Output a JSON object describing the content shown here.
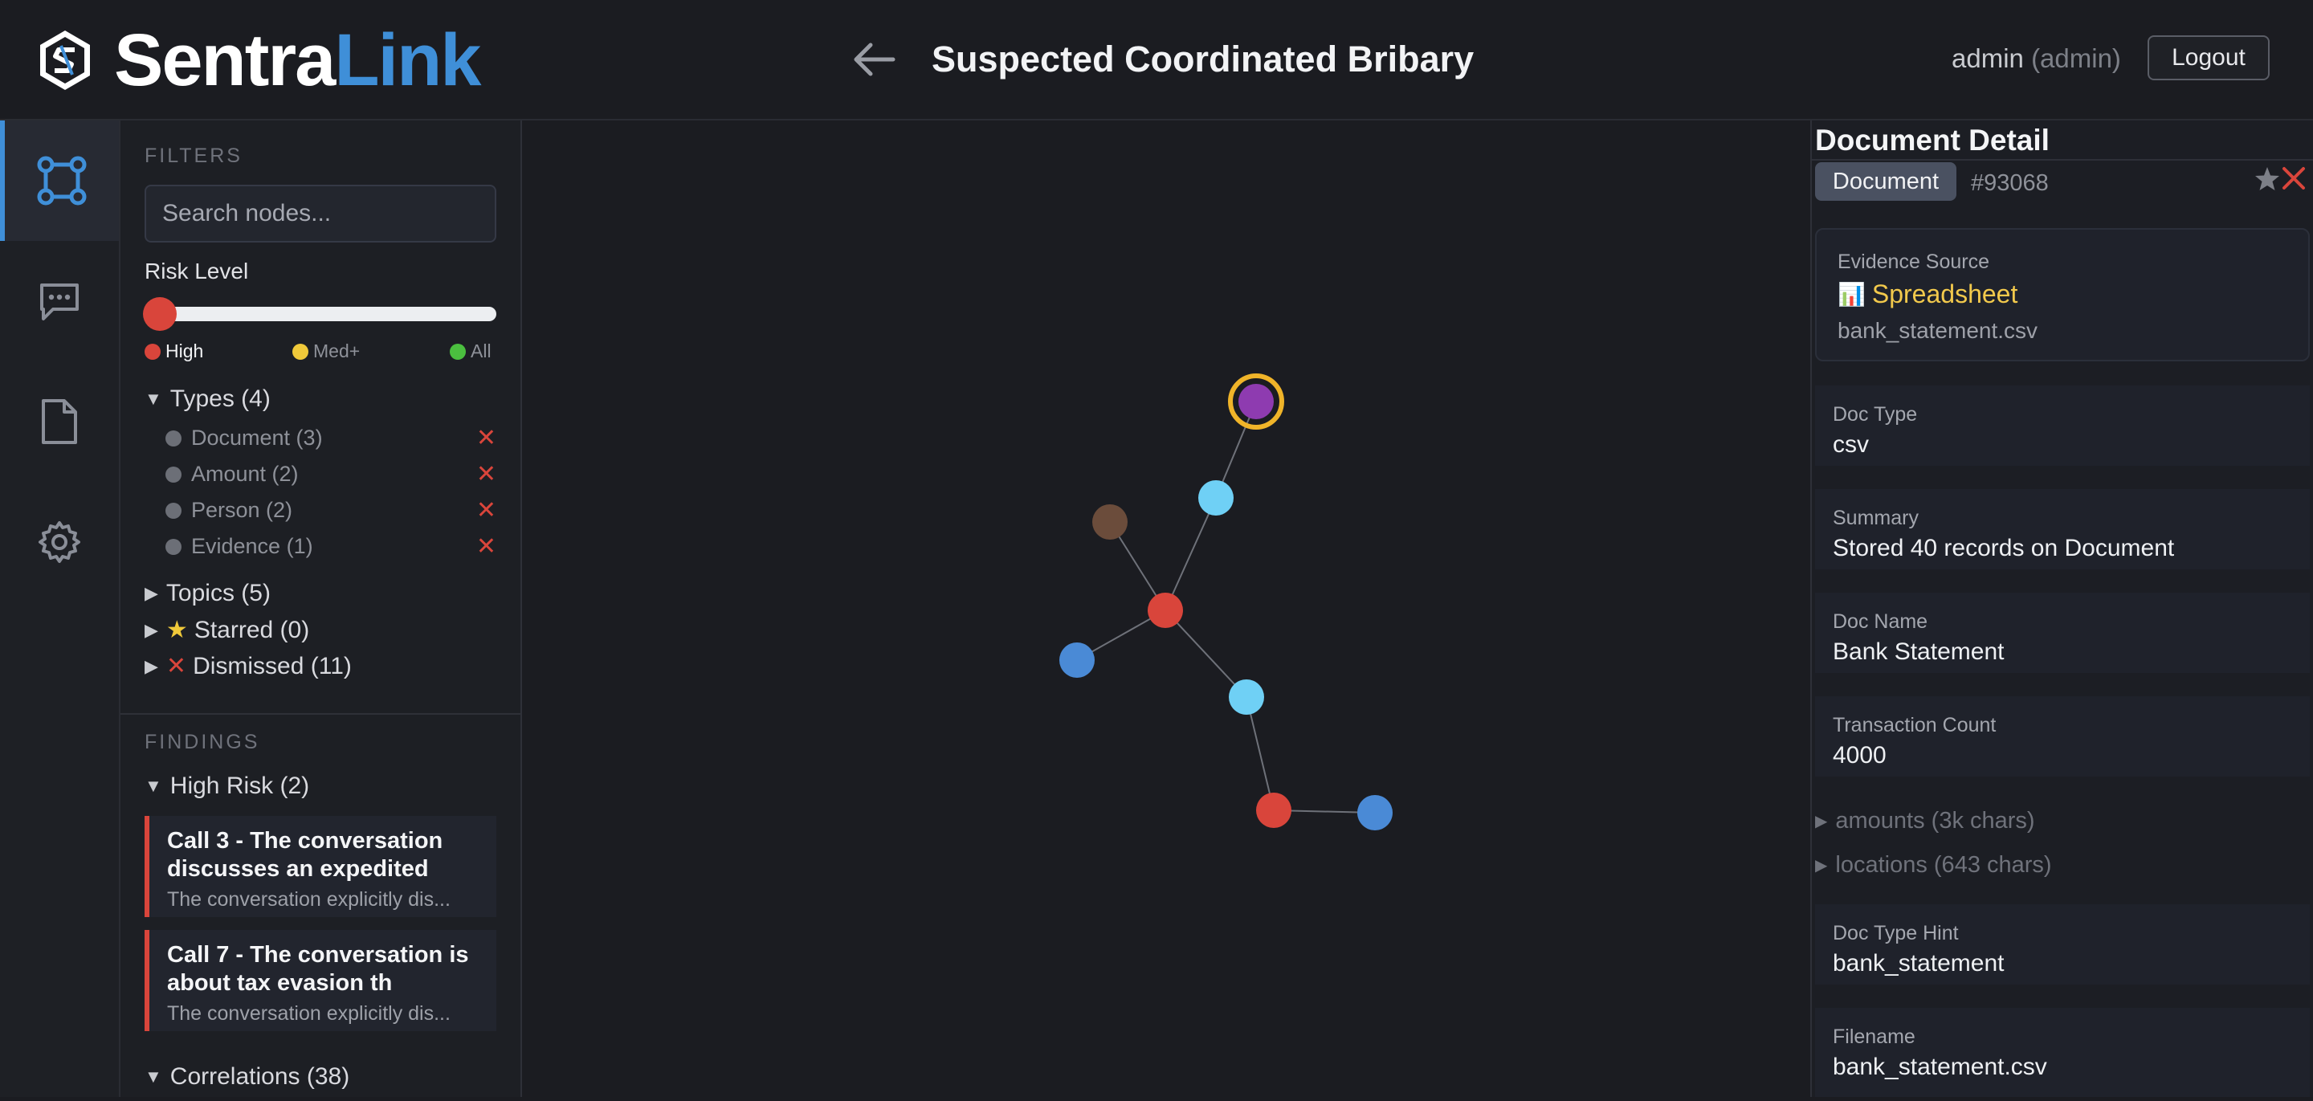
{
  "header": {
    "logo_primary": "Sentra",
    "logo_secondary": "Link",
    "page_title": "Suspected Coordinated Bribary",
    "user_name": "admin",
    "user_role": "(admin)",
    "logout_label": "Logout"
  },
  "rail": {
    "items": [
      {
        "name": "graph-icon",
        "active": true
      },
      {
        "name": "chat-icon",
        "active": false
      },
      {
        "name": "document-icon",
        "active": false
      },
      {
        "name": "gear-icon",
        "active": false
      }
    ]
  },
  "filters": {
    "section_label": "FILTERS",
    "search_placeholder": "Search nodes...",
    "risk_label": "Risk Level",
    "risk_options": [
      {
        "label": "High",
        "color": "#d9453b"
      },
      {
        "label": "Med+",
        "color": "#f0c93a"
      },
      {
        "label": "All",
        "color": "#4bbf3f"
      }
    ],
    "types_label": "Types (4)",
    "types": [
      {
        "label": "Document (3)"
      },
      {
        "label": "Amount (2)"
      },
      {
        "label": "Person (2)"
      },
      {
        "label": "Evidence (1)"
      }
    ],
    "topics_label": "Topics (5)",
    "starred_label": "Starred (0)",
    "dismissed_label": "Dismissed (11)"
  },
  "findings": {
    "section_label": "FINDINGS",
    "high_risk_label": "High Risk (2)",
    "items": [
      {
        "title": "Call 3 - The conversation discusses an expedited",
        "summary": "The conversation explicitly dis..."
      },
      {
        "title": "Call 7 - The conversation is about tax evasion th",
        "summary": "The conversation explicitly dis..."
      }
    ],
    "correlations_label": "Correlations (38)"
  },
  "graph": {
    "selected_ring_color": "#f0b429"
  },
  "detail": {
    "title": "Document Detail",
    "badge": "Document",
    "doc_id": "#93068",
    "evidence_label": "Evidence Source",
    "evidence_icon": "📊",
    "evidence_type": "Spreadsheet",
    "evidence_file": "bank_statement.csv",
    "fields": [
      {
        "label": "Doc Type",
        "value": "csv"
      },
      {
        "label": "Summary",
        "value": "Stored 40 records on Document"
      },
      {
        "label": "Doc Name",
        "value": "Bank Statement"
      },
      {
        "label": "Transaction Count",
        "value": "4000"
      }
    ],
    "collapsed": [
      {
        "label": "amounts (3k chars)"
      },
      {
        "label": "locations (643 chars)"
      }
    ],
    "fields_after": [
      {
        "label": "Doc Type Hint",
        "value": "bank_statement"
      },
      {
        "label": "Filename",
        "value": "bank_statement.csv"
      }
    ]
  }
}
